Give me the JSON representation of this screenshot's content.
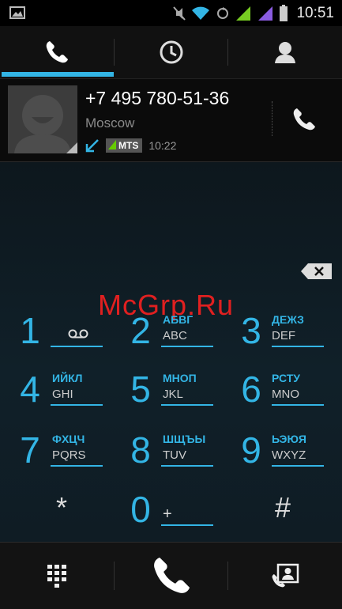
{
  "status_bar": {
    "time": "10:51",
    "icons": [
      "image-notification-icon",
      "mute-icon",
      "wifi-icon",
      "sync-icon",
      "signal-sim1-icon",
      "signal-sim2-icon",
      "battery-icon"
    ]
  },
  "tabs": [
    {
      "name": "phone",
      "icon": "phone-icon",
      "active": true
    },
    {
      "name": "call-log",
      "icon": "clock-icon",
      "active": false
    },
    {
      "name": "contacts",
      "icon": "person-icon",
      "active": false
    }
  ],
  "recent_call": {
    "number": "+7 495 780-51-36",
    "location": "Moscow",
    "type_icon": "incoming-call-arrow-icon",
    "sim": "MTS",
    "time": "10:22"
  },
  "watermark": "McGrp.Ru",
  "keypad": [
    {
      "digit": "1",
      "cyrillic": "",
      "latin": "",
      "extra_icon": "voicemail-icon"
    },
    {
      "digit": "2",
      "cyrillic": "АБВГ",
      "latin": "ABC"
    },
    {
      "digit": "3",
      "cyrillic": "ДЕЖЗ",
      "latin": "DEF"
    },
    {
      "digit": "4",
      "cyrillic": "ИЙКЛ",
      "latin": "GHI"
    },
    {
      "digit": "5",
      "cyrillic": "МНОП",
      "latin": "JKL"
    },
    {
      "digit": "6",
      "cyrillic": "РСТУ",
      "latin": "MNO"
    },
    {
      "digit": "7",
      "cyrillic": "ФХЦЧ",
      "latin": "PQRS"
    },
    {
      "digit": "8",
      "cyrillic": "ШЩЪЫ",
      "latin": "TUV"
    },
    {
      "digit": "9",
      "cyrillic": "ЬЭЮЯ",
      "latin": "WXYZ"
    },
    {
      "digit": "*"
    },
    {
      "digit": "0",
      "latin": "+"
    },
    {
      "digit": "#"
    }
  ],
  "bottom_bar": {
    "left_icon": "dialpad-icon",
    "center_icon": "call-icon",
    "right_icon": "contact-card-icon"
  },
  "colors": {
    "accent": "#33b5e5",
    "watermark": "#e02020"
  }
}
